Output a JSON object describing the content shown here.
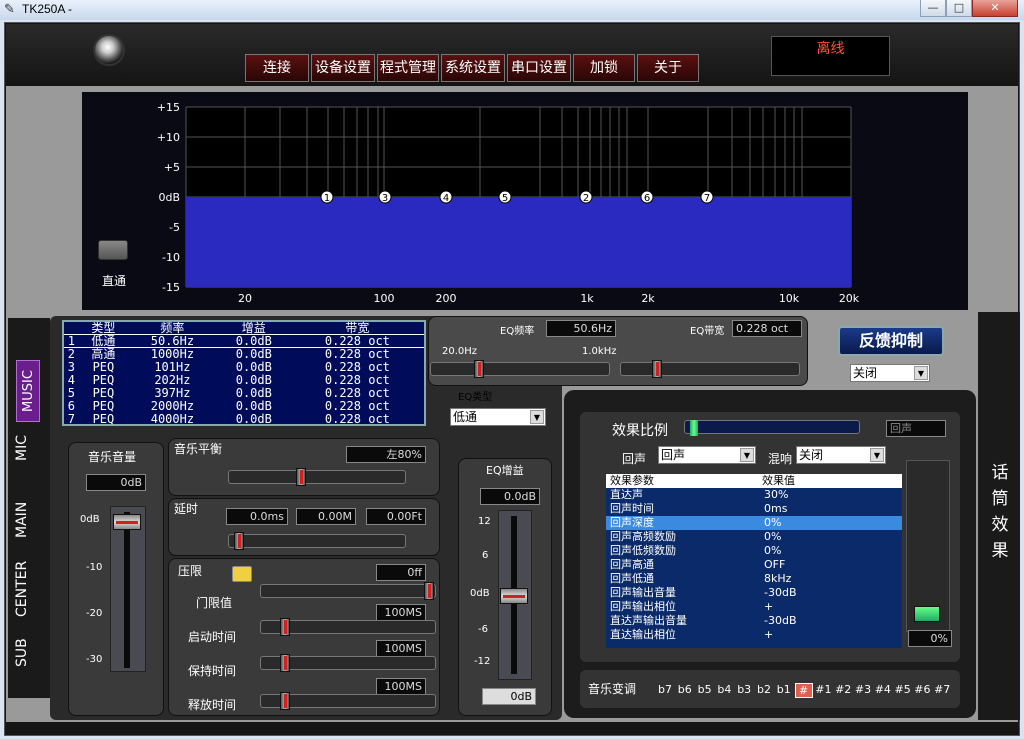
{
  "window": {
    "title": "TK250A -",
    "min": "—",
    "max": "□",
    "close": "✕"
  },
  "menu": [
    "连接",
    "设备设置",
    "程式管理",
    "系统设置",
    "串口设置",
    "加锁",
    "关于"
  ],
  "status": "离线",
  "graph": {
    "y_labels": [
      "+15",
      "+10",
      "+5",
      "0dB",
      "-5",
      "-10",
      "-15"
    ],
    "x_labels": [
      "20",
      "100",
      "200",
      "1k",
      "2k",
      "10k",
      "20k"
    ],
    "markers": [
      "1",
      "3",
      "4",
      "5",
      "2",
      "6",
      "7"
    ],
    "bypass_label": "直通"
  },
  "bands": {
    "headers": [
      "类型",
      "频率",
      "增益",
      "带宽"
    ],
    "rows": [
      [
        "1",
        "低通",
        "50.6Hz",
        "0.0dB",
        "0.228 oct"
      ],
      [
        "2",
        "高通",
        "1000Hz",
        "0.0dB",
        "0.228 oct"
      ],
      [
        "3",
        "PEQ",
        "101Hz",
        "0.0dB",
        "0.228 oct"
      ],
      [
        "4",
        "PEQ",
        "202Hz",
        "0.0dB",
        "0.228 oct"
      ],
      [
        "5",
        "PEQ",
        "397Hz",
        "0.0dB",
        "0.228 oct"
      ],
      [
        "6",
        "PEQ",
        "2000Hz",
        "0.0dB",
        "0.228 oct"
      ],
      [
        "7",
        "PEQ",
        "4000Hz",
        "0.0dB",
        "0.228 oct"
      ]
    ]
  },
  "eq": {
    "freq_label": "EQ频率",
    "freq_value": "50.6Hz",
    "bw_label": "EQ带宽",
    "bw_value": "0.228 oct",
    "range_low": "20.0Hz",
    "range_high": "1.0kHz",
    "type_label": "EQ类型",
    "type_value": "低通",
    "gain_label": "EQ增益",
    "gain_value": "0.0dB",
    "gain_ticks": [
      "12",
      "6",
      "0dB",
      "-6",
      "-12"
    ],
    "gain_bottom": "0dB"
  },
  "side_tabs": [
    "MUSIC",
    "MIC",
    "MAIN",
    "CENTER",
    "SUB"
  ],
  "music_volume": {
    "title": "音乐音量",
    "value": "0dB",
    "ticks": [
      "0dB",
      "-10",
      "-20",
      "-30"
    ]
  },
  "balance": {
    "title": "音乐平衡",
    "value": "左80%"
  },
  "delay": {
    "title": "延时",
    "ms": "0.0ms",
    "m": "0.00M",
    "ft": "0.00Ft"
  },
  "limiter": {
    "title": "压限",
    "value": "0ff",
    "rows": [
      {
        "label": "门限值",
        "value": "100MS"
      },
      {
        "label": "启动时间",
        "value": "100MS"
      },
      {
        "label": "保持时间",
        "value": "100MS"
      },
      {
        "label": "释放时间",
        "value": ""
      }
    ]
  },
  "feedback": {
    "title": "反馈抑制",
    "value": "关闭"
  },
  "effects": {
    "ratio_label": "效果比例",
    "ratio_value": "回声",
    "echo_label": "回声",
    "echo_value": "回声",
    "reverb_label": "混响",
    "reverb_value": "关闭",
    "col_param": "效果参数",
    "col_value": "效果值",
    "rows": [
      [
        "直达声",
        "30%"
      ],
      [
        "回声时间",
        "0ms"
      ],
      [
        "回声深度",
        "0%"
      ],
      [
        "回声高频数励",
        "0%"
      ],
      [
        "回声低频数励",
        "0%"
      ],
      [
        "回声高通",
        "OFF"
      ],
      [
        "回声低通",
        "8kHz"
      ],
      [
        "回声输出音量",
        "-30dB"
      ],
      [
        "回声输出相位",
        "+"
      ],
      [
        "直达声输出音量",
        "-30dB"
      ],
      [
        "直达输出相位",
        "+"
      ]
    ],
    "vu_value": "0%"
  },
  "key": {
    "label": "音乐变调",
    "keys": [
      "b7",
      "b6",
      "b5",
      "b4",
      "b3",
      "b2",
      "b1",
      "#",
      "#1",
      "#2",
      "#3",
      "#4",
      "#5",
      "#6",
      "#7"
    ],
    "selected": 7
  },
  "mic_effects": "话筒效果",
  "colors": {
    "curve_fill": "#2a2ac0",
    "accent": "#c22",
    "status": "#ff5533"
  }
}
